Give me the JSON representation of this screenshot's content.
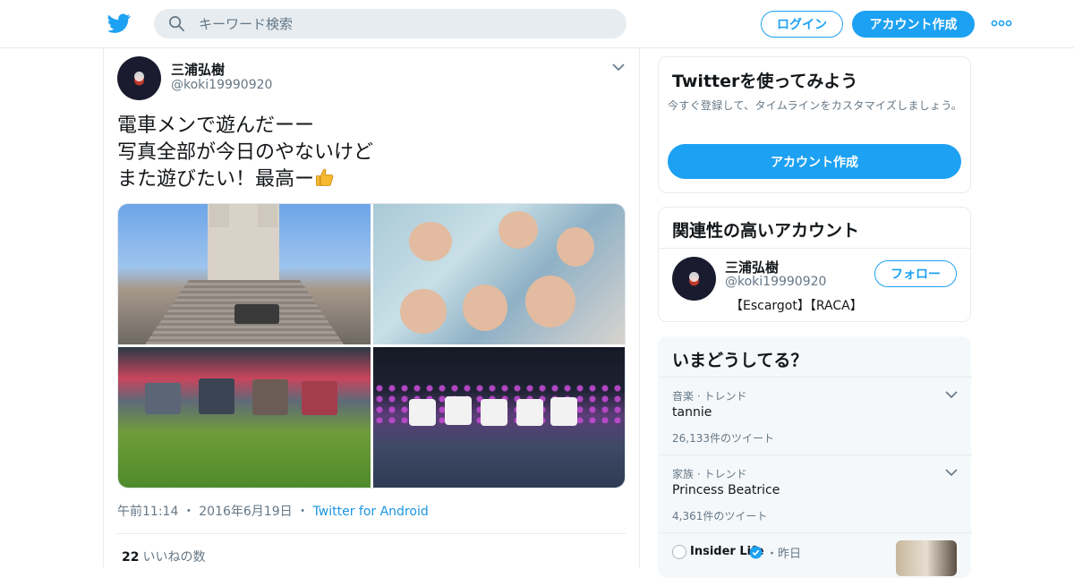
{
  "colors": {
    "accent": "#1da1f2",
    "link": "#1b95e0",
    "muted": "#657786",
    "text": "#14171a"
  },
  "header": {
    "logo_icon": "twitter-bird-icon",
    "search_placeholder": "キーワード検索",
    "login_label": "ログイン",
    "signup_label": "アカウント作成",
    "more_icon": "more-dots-icon"
  },
  "tweet": {
    "author_name": "三浦弘樹",
    "author_handle": "@koki19990920",
    "text_lines": [
      "電車メンで遊んだーー",
      "写真全部が今日のやないけど",
      "また遊びたい！最高ー"
    ],
    "emoji": "thumbs-up-icon",
    "time": "午前11:14",
    "dot1": "・",
    "date": "2016年6月19日",
    "dot2": "・",
    "source": "Twitter for Android",
    "likes_count": "22",
    "likes_label": "いいねの数"
  },
  "signup_card": {
    "title": "Twitterを使ってみよう",
    "description": "今すぐ登録して、タイムラインをカスタマイズしましょう。",
    "button_label": "アカウント作成"
  },
  "related_card": {
    "title": "関連性の高いアカウント",
    "account_name": "三浦弘樹",
    "account_handle": "@koki19990920",
    "account_bio": "【Escargot】【RACA】",
    "follow_label": "フォロー"
  },
  "trends_card": {
    "title": "いまどうしてる？",
    "trends": [
      {
        "context": "音楽 · トレンド",
        "name": "tannie",
        "count": "26,133件のツイート"
      },
      {
        "context": "家族 · トレンド",
        "name": "Princess Beatrice",
        "count": "4,361件のツイート"
      }
    ],
    "news": {
      "source": "Insider Life",
      "dot": "・",
      "time": "昨日"
    }
  }
}
